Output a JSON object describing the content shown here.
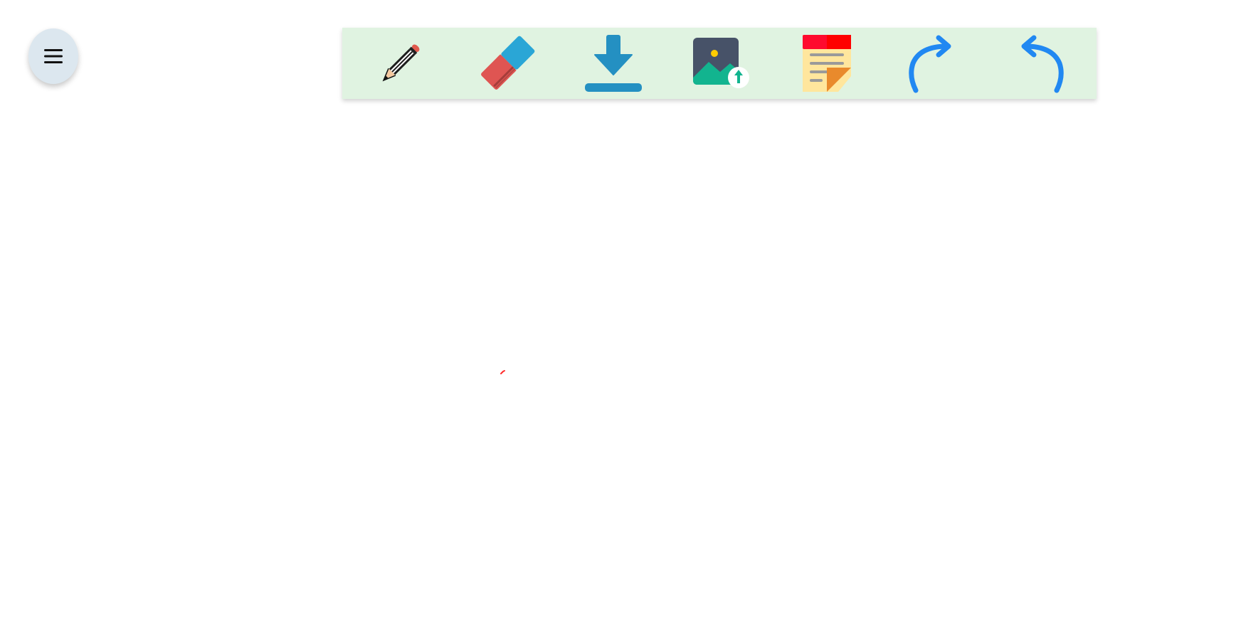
{
  "menu": {
    "icon": "hamburger-menu-icon"
  },
  "toolbar": {
    "background_color": "#e0f3e1",
    "tools": [
      {
        "name": "pencil",
        "icon": "pencil-icon"
      },
      {
        "name": "eraser",
        "icon": "eraser-icon"
      },
      {
        "name": "download",
        "icon": "download-icon"
      },
      {
        "name": "upload-image",
        "icon": "image-upload-icon"
      },
      {
        "name": "sticky-note",
        "icon": "sticky-note-icon"
      },
      {
        "name": "redo",
        "icon": "redo-icon"
      },
      {
        "name": "undo",
        "icon": "undo-icon"
      }
    ]
  },
  "canvas": {
    "stroke_color": "#ff2b2b"
  },
  "colors": {
    "menu_button": "#dce7ef",
    "arrow_blue": "#2188f2",
    "download_blue": "#2490c2",
    "pencil_tip": "#e05a4e",
    "eraser_red": "#df5552",
    "eraser_blue": "#2aa6d6",
    "image_frame": "#475268",
    "image_green": "#12b48f",
    "note_yellow": "#ffe69d",
    "note_red": "#ff0a2e",
    "note_fold": "#e98a2c"
  }
}
